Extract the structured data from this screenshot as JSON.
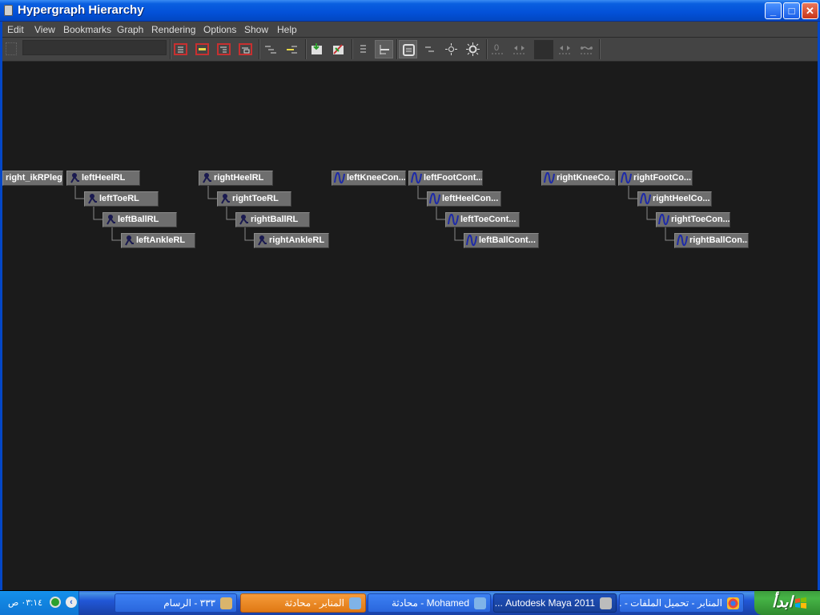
{
  "window": {
    "title": "Hypergraph Hierarchy",
    "controls": {
      "minimize": "_",
      "maximize": "□",
      "close": "✕"
    }
  },
  "menu": [
    "Edit",
    "View",
    "Bookmarks",
    "Graph",
    "Rendering",
    "Options",
    "Show",
    "Help"
  ],
  "toolbar": {
    "search_value": "",
    "buttons": [
      "frame-all",
      "frame-selection",
      "frame-hierarchy",
      "frame-branch",
      "collapse",
      "expand",
      "add-bookmark",
      "bookmark-editor",
      "scene-hierarchy",
      "input-output-connections",
      "graph-view",
      "freeform-layout",
      "show-nodes",
      "show-all-nodes",
      "zero",
      "left-right",
      "swatch",
      "previous-view",
      "next-view"
    ]
  },
  "nodes": [
    {
      "id": "right_ikRPleg",
      "label": "right_ikRPleg",
      "icon": "none"
    },
    {
      "id": "leftHeelRL",
      "label": "leftHeelRL",
      "icon": "joint"
    },
    {
      "id": "leftToeRL",
      "label": "leftToeRL",
      "icon": "joint"
    },
    {
      "id": "leftBallRL",
      "label": "leftBallRL",
      "icon": "joint"
    },
    {
      "id": "leftAnkleRL",
      "label": "leftAnkleRL",
      "icon": "joint"
    },
    {
      "id": "rightHeelRL",
      "label": "rightHeelRL",
      "icon": "joint"
    },
    {
      "id": "rightToeRL",
      "label": "rightToeRL",
      "icon": "joint"
    },
    {
      "id": "rightBallRL",
      "label": "rightBallRL",
      "icon": "joint"
    },
    {
      "id": "rightAnkleRL",
      "label": "rightAnkleRL",
      "icon": "joint"
    },
    {
      "id": "leftKneeCon",
      "label": "leftKneeCon...",
      "icon": "curve"
    },
    {
      "id": "leftFootCont",
      "label": "leftFootCont...",
      "icon": "curve"
    },
    {
      "id": "leftHeelCon",
      "label": "leftHeelCon...",
      "icon": "curve"
    },
    {
      "id": "leftToeCont",
      "label": "leftToeCont...",
      "icon": "curve"
    },
    {
      "id": "leftBallCont",
      "label": "leftBallCont...",
      "icon": "curve"
    },
    {
      "id": "rightKneeCo",
      "label": "rightKneeCo...",
      "icon": "curve"
    },
    {
      "id": "rightFootCo",
      "label": "rightFootCo...",
      "icon": "curve"
    },
    {
      "id": "rightHeelCo",
      "label": "rightHeelCo...",
      "icon": "curve"
    },
    {
      "id": "rightToeCon",
      "label": "rightToeCon...",
      "icon": "curve"
    },
    {
      "id": "rightBallCon",
      "label": "rightBallCon...",
      "icon": "curve"
    }
  ],
  "taskbar": {
    "start_label": "ابدأ",
    "tasks": [
      {
        "label": "المنابر - تحميل الملفات - ...",
        "icon": "chrome-icon"
      },
      {
        "label": "Autodesk Maya 2011 ...",
        "icon": "maya-icon"
      },
      {
        "label": "Mohamed - محادثة",
        "icon": "messenger-icon"
      },
      {
        "label": "المنابر - محادثة",
        "icon": "messenger-icon"
      },
      {
        "label": "٣٣٣ - الرسام",
        "icon": "paint-icon"
      }
    ],
    "clock": "٠٣:١٤ ص"
  },
  "colors": {
    "canvas": "#1b1b1b",
    "node": "#6e6e6e",
    "node_text": "#ffffff",
    "joint_icon": "#1a1a50",
    "curve_icon": "#1d2aa8",
    "titlebar": "#0351d8"
  }
}
